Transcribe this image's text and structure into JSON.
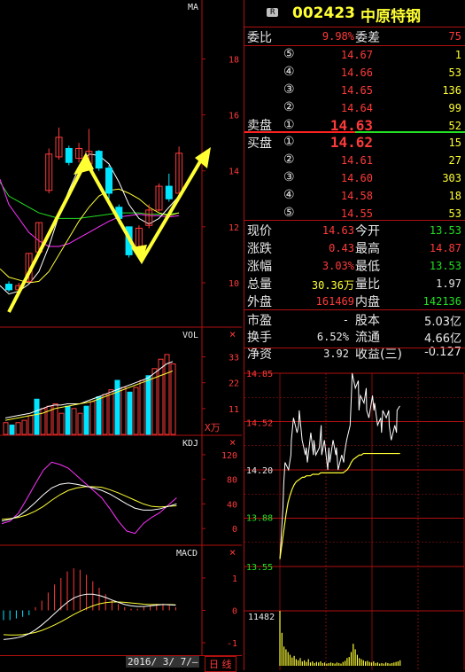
{
  "stock": {
    "badge": "R",
    "code": "002423",
    "name": "中原特钢"
  },
  "kline": {
    "ma_label": "MA",
    "y_ticks": [
      "18",
      "16",
      "14",
      "12",
      "10"
    ],
    "candles": [
      {
        "o": 9.95,
        "c": 9.75,
        "h": 10.05,
        "l": 9.68
      },
      {
        "o": 9.75,
        "c": 9.9,
        "h": 10.0,
        "l": 9.7
      },
      {
        "o": 10.05,
        "c": 11.05,
        "h": 11.05,
        "l": 10.0
      },
      {
        "o": 11.1,
        "c": 12.15,
        "h": 12.15,
        "l": 11.05
      },
      {
        "o": 13.3,
        "c": 14.6,
        "h": 14.8,
        "l": 13.2
      },
      {
        "o": 14.5,
        "c": 15.2,
        "h": 15.55,
        "l": 14.4
      },
      {
        "o": 14.8,
        "c": 14.3,
        "h": 14.9,
        "l": 14.2
      },
      {
        "o": 14.45,
        "c": 14.8,
        "h": 15.0,
        "l": 14.3
      },
      {
        "o": 14.25,
        "c": 14.7,
        "h": 15.5,
        "l": 14.2
      },
      {
        "o": 14.7,
        "c": 14.1,
        "h": 14.75,
        "l": 14.0
      },
      {
        "o": 14.1,
        "c": 13.2,
        "h": 14.2,
        "l": 13.0
      },
      {
        "o": 12.7,
        "c": 12.3,
        "h": 12.8,
        "l": 12.1
      },
      {
        "o": 12.0,
        "c": 11.0,
        "h": 12.0,
        "l": 10.9
      },
      {
        "o": 11.1,
        "c": 11.95,
        "h": 12.05,
        "l": 10.95
      },
      {
        "o": 12.05,
        "c": 12.6,
        "h": 12.8,
        "l": 11.95
      },
      {
        "o": 12.6,
        "c": 13.45,
        "h": 13.55,
        "l": 12.55
      },
      {
        "o": 13.45,
        "c": 13.0,
        "h": 13.9,
        "l": 12.9
      },
      {
        "o": 13.2,
        "c": 14.63,
        "h": 14.87,
        "l": 13.2
      }
    ],
    "ma5": [
      9.6,
      9.7,
      9.95,
      10.4,
      11.3,
      12.4,
      13.3,
      14.1,
      14.6,
      14.55,
      14.25,
      13.6,
      12.8,
      12.3,
      12.1,
      12.3,
      12.7,
      13.1
    ],
    "ma10": [
      10.2,
      10.1,
      10.0,
      10.05,
      10.4,
      11.0,
      11.6,
      12.2,
      12.7,
      13.1,
      13.3,
      13.35,
      13.2,
      13.0,
      12.7,
      12.5,
      12.4,
      12.5
    ],
    "ma20": [
      12.8,
      12.3,
      11.8,
      11.5,
      11.3,
      11.3,
      11.4,
      11.6,
      11.8,
      12.0,
      12.2,
      12.35,
      12.4,
      12.45,
      12.4,
      12.4,
      12.35,
      12.4
    ],
    "ma30": [
      13.1,
      12.9,
      12.7,
      12.5,
      12.4,
      12.3,
      12.3,
      12.3,
      12.35,
      12.4,
      12.45,
      12.5,
      12.5,
      12.5,
      12.45,
      12.45,
      12.45,
      12.5
    ]
  },
  "vol": {
    "label": "VOL",
    "y_ticks": [
      "33",
      "22",
      "11"
    ],
    "unit": "X万",
    "bars": [
      5,
      4,
      5,
      6,
      8,
      15,
      11,
      12,
      13,
      9,
      12,
      11,
      9,
      12,
      14,
      16,
      17,
      19,
      23,
      20,
      18,
      20,
      23,
      25,
      28,
      32,
      34,
      30
    ],
    "bar_up": [
      true,
      false,
      true,
      true,
      true,
      false,
      true,
      true,
      true,
      true,
      false,
      true,
      true,
      false,
      true,
      false,
      true,
      true,
      false,
      true,
      false,
      true,
      true,
      false,
      true,
      true,
      true,
      true
    ],
    "mv5": [
      7,
      7.5,
      8,
      8.5,
      9,
      10,
      11,
      12,
      12.5,
      12.5,
      13,
      13,
      13,
      14,
      15,
      16,
      17,
      18,
      19,
      20,
      21,
      22,
      23,
      24,
      26,
      28,
      30,
      31
    ],
    "mv10": [
      6,
      6.5,
      7,
      7.5,
      8,
      8.5,
      9,
      10,
      11,
      11.5,
      12,
      12.5,
      13,
      13.5,
      14,
      15,
      16,
      17,
      18,
      19,
      20,
      21,
      22,
      23,
      24,
      25,
      26,
      27
    ]
  },
  "kdj": {
    "label": "KDJ",
    "y_ticks": [
      "120",
      "80",
      "40",
      "0"
    ],
    "k": [
      12,
      15,
      20,
      30,
      42,
      55,
      66,
      72,
      74,
      72,
      69,
      66,
      62,
      56,
      48,
      40,
      33,
      30,
      30,
      32,
      36,
      40
    ],
    "d": [
      15,
      16,
      18,
      22,
      28,
      36,
      46,
      55,
      62,
      66,
      68,
      68,
      67,
      63,
      58,
      52,
      46,
      40,
      36,
      35,
      36,
      37
    ],
    "j": [
      8,
      12,
      25,
      48,
      72,
      95,
      108,
      104,
      98,
      86,
      74,
      62,
      50,
      32,
      12,
      -4,
      -8,
      8,
      18,
      26,
      38,
      50
    ]
  },
  "macd": {
    "label": "MACD",
    "y_ticks": [
      "1",
      "0",
      "-1"
    ],
    "hist": [
      -0.3,
      -0.3,
      -0.25,
      -0.2,
      -0.15,
      0.1,
      0.3,
      0.55,
      0.8,
      1.0,
      1.2,
      1.3,
      1.25,
      1.1,
      0.9,
      0.7,
      0.5,
      0.3,
      0.2,
      0.1,
      0.05,
      0.05,
      0.1,
      0.15,
      0.2,
      0.2,
      0.15,
      0.1
    ],
    "dif": [
      -0.9,
      -0.88,
      -0.85,
      -0.8,
      -0.72,
      -0.6,
      -0.45,
      -0.28,
      -0.1,
      0.08,
      0.25,
      0.38,
      0.46,
      0.5,
      0.5,
      0.46,
      0.4,
      0.32,
      0.25,
      0.18,
      0.14,
      0.12,
      0.12,
      0.14,
      0.16,
      0.18,
      0.17,
      0.16
    ],
    "dea": [
      -0.75,
      -0.76,
      -0.76,
      -0.75,
      -0.72,
      -0.68,
      -0.62,
      -0.54,
      -0.45,
      -0.35,
      -0.24,
      -0.13,
      -0.03,
      0.06,
      0.14,
      0.2,
      0.24,
      0.26,
      0.26,
      0.25,
      0.23,
      0.21,
      0.19,
      0.18,
      0.18,
      0.18,
      0.18,
      0.17
    ]
  },
  "footer": {
    "date": "2016/ 3/ 7/—",
    "period": "日 线"
  },
  "quote": {
    "wei_bi_label": "委比",
    "wei_bi": "9.98%",
    "wei_cha_label": "委差",
    "wei_cha": "75",
    "sell_label": "卖盘",
    "buy_label": "买盘",
    "sell": [
      {
        "lvl": "⑤",
        "price": "14.67",
        "vol": "1"
      },
      {
        "lvl": "④",
        "price": "14.66",
        "vol": "53"
      },
      {
        "lvl": "③",
        "price": "14.65",
        "vol": "136"
      },
      {
        "lvl": "②",
        "price": "14.64",
        "vol": "99"
      },
      {
        "lvl": "①",
        "price": "14.63",
        "vol": "52"
      }
    ],
    "buy": [
      {
        "lvl": "①",
        "price": "14.62",
        "vol": "15"
      },
      {
        "lvl": "②",
        "price": "14.61",
        "vol": "27"
      },
      {
        "lvl": "③",
        "price": "14.60",
        "vol": "303"
      },
      {
        "lvl": "④",
        "price": "14.58",
        "vol": "18"
      },
      {
        "lvl": "⑤",
        "price": "14.55",
        "vol": "53"
      }
    ],
    "stats": [
      {
        "l1": "现价",
        "v1": "14.63",
        "c1": "#ff3a3a",
        "l2": "今开",
        "v2": "13.53",
        "c2": "#22e022"
      },
      {
        "l1": "涨跌",
        "v1": "0.43",
        "c1": "#ff3a3a",
        "l2": "最高",
        "v2": "14.87",
        "c2": "#ff3a3a"
      },
      {
        "l1": "涨幅",
        "v1": "3.03%",
        "c1": "#ff3a3a",
        "l2": "最低",
        "v2": "13.53",
        "c2": "#22e022"
      },
      {
        "l1": "总量",
        "v1": "30.36万",
        "c1": "#ffff33",
        "l2": "量比",
        "v2": "1.97",
        "c2": "#e8e8e8"
      },
      {
        "l1": "外盘",
        "v1": "161469",
        "c1": "#ff3a3a",
        "l2": "内盘",
        "v2": "142136",
        "c2": "#22e022"
      }
    ],
    "stats2": [
      {
        "l1": "市盈",
        "v1": "-",
        "l2": "股本",
        "v2": "5.03亿"
      },
      {
        "l1": "换手",
        "v1": "6.52%",
        "l2": "流通",
        "v2": "4.66亿"
      },
      {
        "l1": "净资",
        "v1": "3.92",
        "l2": "收益(三)",
        "v2": "-0.127"
      }
    ]
  },
  "intraday": {
    "y_ticks": [
      {
        "v": "14.85",
        "c": "#ff3a3a"
      },
      {
        "v": "14.52",
        "c": "#ff3a3a"
      },
      {
        "v": "14.20",
        "c": "#e8e8e8"
      },
      {
        "v": "13.88",
        "c": "#22e022"
      },
      {
        "v": "13.55",
        "c": "#22e022"
      }
    ],
    "vol_label": "11482",
    "price": [
      13.6,
      13.95,
      14.1,
      14.25,
      14.2,
      14.3,
      14.4,
      14.55,
      14.45,
      14.5,
      14.6,
      14.4,
      14.3,
      14.35,
      14.25,
      14.45,
      14.3,
      14.4,
      14.3,
      14.35,
      14.5,
      14.3,
      14.4,
      14.2,
      14.35,
      14.25,
      14.4,
      14.3,
      14.35,
      14.2,
      14.3,
      14.25,
      14.3,
      14.4,
      14.5,
      14.7,
      14.85,
      14.75,
      14.8,
      14.6,
      14.7,
      14.65,
      14.75,
      14.6,
      14.55,
      14.7,
      14.6,
      14.65,
      14.5,
      14.55,
      14.45,
      14.6,
      14.55,
      14.6,
      14.5,
      14.4,
      14.5,
      14.45,
      14.6,
      14.63
    ],
    "avg": [
      13.6,
      13.7,
      13.8,
      13.9,
      13.98,
      14.03,
      14.07,
      14.1,
      14.12,
      14.13,
      14.14,
      14.15,
      14.15,
      14.16,
      14.16,
      14.16,
      14.17,
      14.17,
      14.17,
      14.17,
      14.18,
      14.18,
      14.18,
      14.18,
      14.18,
      14.18,
      14.18,
      14.18,
      14.18,
      14.18,
      14.18,
      14.18,
      14.19,
      14.2,
      14.22,
      14.25,
      14.27,
      14.28,
      14.29,
      14.3,
      14.3,
      14.31,
      14.31,
      14.31,
      14.31,
      14.31,
      14.31,
      14.31,
      14.31,
      14.31,
      14.31,
      14.31,
      14.31,
      14.31,
      14.31,
      14.31,
      14.31,
      14.31,
      14.31,
      14.31
    ],
    "vol": [
      100,
      60,
      35,
      30,
      25,
      20,
      15,
      18,
      12,
      10,
      14,
      8,
      10,
      7,
      12,
      6,
      8,
      5,
      7,
      6,
      8,
      5,
      6,
      4,
      5,
      6,
      5,
      4,
      6,
      5,
      4,
      7,
      9,
      14,
      16,
      25,
      40,
      30,
      20,
      14,
      12,
      10,
      8,
      9,
      7,
      6,
      8,
      5,
      6,
      4,
      5,
      4,
      6,
      5,
      4,
      5,
      6,
      7,
      8,
      10
    ]
  },
  "colors": {
    "up": "#ff3a3a",
    "down": "#00e5ff",
    "frame": "#b01010",
    "arrow": "#ffff33"
  }
}
